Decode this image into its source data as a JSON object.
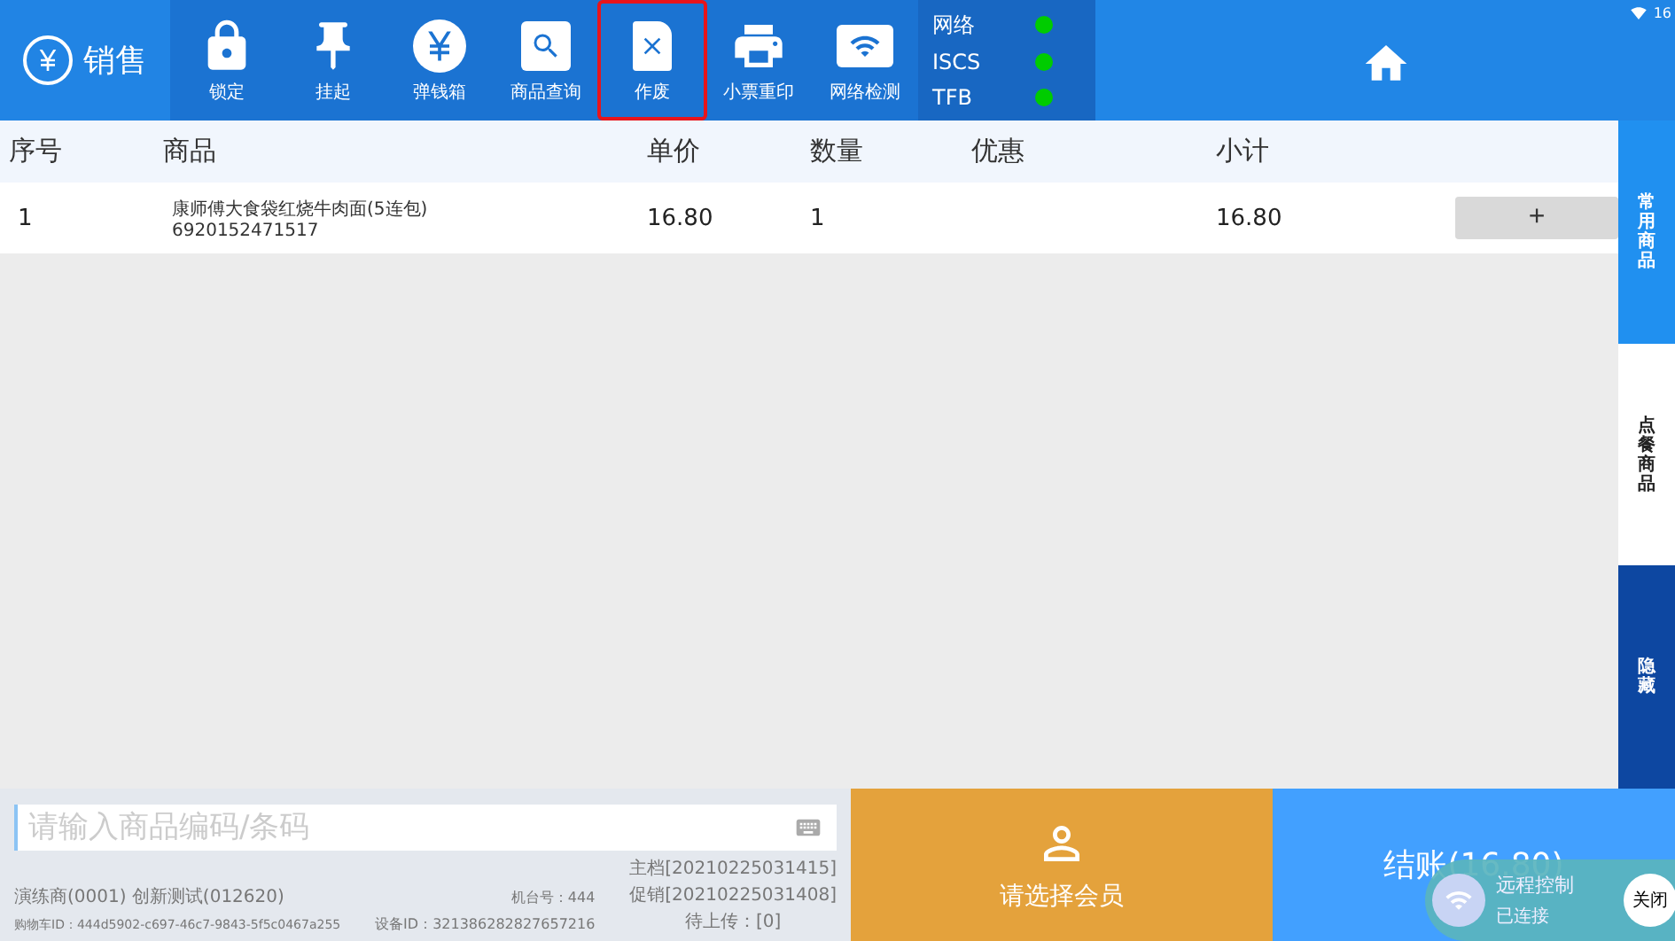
{
  "header": {
    "brand": {
      "label": "销售"
    },
    "toolbar": [
      {
        "kind": "lock",
        "label": "锁定",
        "highlighted": false
      },
      {
        "kind": "pin",
        "label": "挂起",
        "highlighted": false
      },
      {
        "kind": "yen",
        "label": "弹钱箱",
        "highlighted": false
      },
      {
        "kind": "search",
        "label": "商品查询",
        "highlighted": false
      },
      {
        "kind": "void",
        "label": "作废",
        "highlighted": true
      },
      {
        "kind": "print",
        "label": "小票重印",
        "highlighted": false
      },
      {
        "kind": "wifi",
        "label": "网络检测",
        "highlighted": false
      }
    ],
    "status": [
      {
        "label": "网络",
        "color": "#00cc00"
      },
      {
        "label": "ISCS",
        "color": "#00cc00"
      },
      {
        "label": "TFB",
        "color": "#00cc00"
      }
    ],
    "system_time": "16"
  },
  "table": {
    "columns": [
      "序号",
      "商品",
      "单价",
      "数量",
      "优惠",
      "小计"
    ],
    "rows": [
      {
        "index": "1",
        "name": "康师傅大食袋红烧牛肉面(5连包)",
        "barcode": "6920152471517",
        "price": "16.80",
        "quantity": "1",
        "subtotal": "16.80",
        "action": "+"
      }
    ]
  },
  "side_tabs": [
    {
      "kind": "tab",
      "label": "常用商品",
      "selected": false
    },
    {
      "kind": "tab",
      "label": "点餐商品",
      "selected": true
    },
    {
      "kind": "toggle",
      "label": "隐藏",
      "selected": false
    }
  ],
  "search": {
    "placeholder": "请输入商品编码/条码"
  },
  "info": {
    "store": "演练商(0001) 创新测试(012620)",
    "cart_id": "购物车ID：444d5902-c697-46c7-9843-5f5c0467a255",
    "terminal": "机台号：444",
    "device_id": "设备ID：321386282827657216",
    "master": "主档[20210225031415]",
    "promo": "促销[20210225031408]",
    "pending": "待上传：[0]"
  },
  "member_button": {
    "label": "请选择会员"
  },
  "checkout_button": {
    "label": "结账(16.80)"
  },
  "remote_overlay": {
    "title": "远程控制",
    "status": "已连接",
    "close": "关闭"
  }
}
